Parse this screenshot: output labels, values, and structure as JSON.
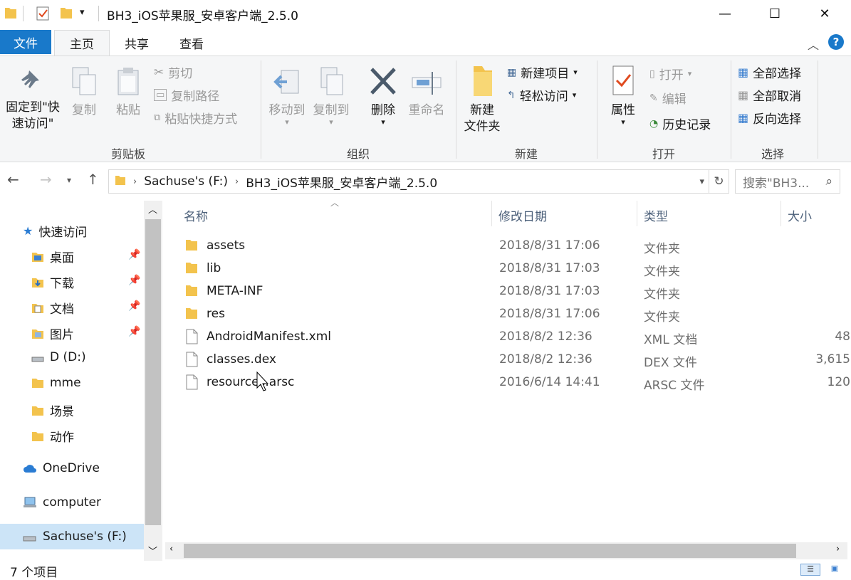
{
  "window": {
    "title": "BH3_iOS苹果服_安卓客户端_2.5.0",
    "minimize": "—",
    "maximize": "☐",
    "close": "✕"
  },
  "tabs": {
    "file": "文件",
    "home": "主页",
    "share": "共享",
    "view": "查看"
  },
  "ribbon": {
    "clipboard": {
      "pin_label_1": "固定到\"快",
      "pin_label_2": "速访问\"",
      "copy": "复制",
      "paste": "粘贴",
      "cut": "剪切",
      "copy_path": "复制路径",
      "paste_shortcut": "粘贴快捷方式",
      "group": "剪贴板"
    },
    "organize": {
      "move_to": "移动到",
      "copy_to": "复制到",
      "delete": "删除",
      "rename": "重命名",
      "group": "组织"
    },
    "new": {
      "new_folder_1": "新建",
      "new_folder_2": "文件夹",
      "new_item": "新建项目",
      "easy_access": "轻松访问",
      "group": "新建"
    },
    "open": {
      "properties": "属性",
      "open": "打开",
      "edit": "编辑",
      "history": "历史记录",
      "group": "打开"
    },
    "select": {
      "select_all": "全部选择",
      "select_none": "全部取消",
      "invert": "反向选择",
      "group": "选择"
    }
  },
  "address": {
    "drive": "Sachuse's (F:)",
    "folder": "BH3_iOS苹果服_安卓客户端_2.5.0",
    "search_placeholder": "搜索\"BH3..."
  },
  "nav": {
    "quick_access": "快速访问",
    "desktop": "桌面",
    "downloads": "下载",
    "documents": "文档",
    "pictures": "图片",
    "d_drive": "D (D:)",
    "mme": "mme",
    "scene": "场景",
    "action": "动作",
    "onedrive": "OneDrive",
    "computer": "computer",
    "f_drive": "Sachuse's (F:)"
  },
  "columns": {
    "name": "名称",
    "date": "修改日期",
    "type": "类型",
    "size": "大小"
  },
  "files": [
    {
      "name": "assets",
      "date": "2018/8/31 17:06",
      "type": "文件夹",
      "size": "",
      "kind": "folder"
    },
    {
      "name": "lib",
      "date": "2018/8/31 17:03",
      "type": "文件夹",
      "size": "",
      "kind": "folder"
    },
    {
      "name": "META-INF",
      "date": "2018/8/31 17:03",
      "type": "文件夹",
      "size": "",
      "kind": "folder"
    },
    {
      "name": "res",
      "date": "2018/8/31 17:06",
      "type": "文件夹",
      "size": "",
      "kind": "folder"
    },
    {
      "name": "AndroidManifest.xml",
      "date": "2018/8/2 12:36",
      "type": "XML 文档",
      "size": "48",
      "kind": "file"
    },
    {
      "name": "classes.dex",
      "date": "2018/8/2 12:36",
      "type": "DEX 文件",
      "size": "3,615",
      "kind": "file"
    },
    {
      "name": "resources.arsc",
      "date": "2016/6/14 14:41",
      "type": "ARSC 文件",
      "size": "120",
      "kind": "file"
    }
  ],
  "status": {
    "count": "7 个项目"
  },
  "colors": {
    "file_tab": "#1979ca",
    "folder": "#f3c34d",
    "selection": "#cce4f7"
  }
}
